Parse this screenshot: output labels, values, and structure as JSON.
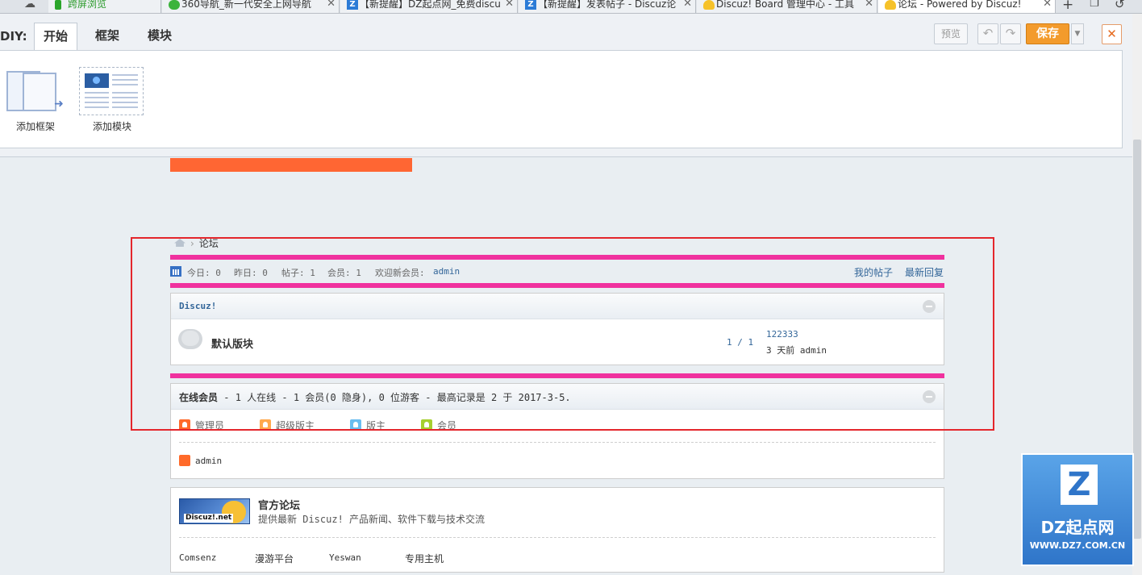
{
  "browser": {
    "tabs": [
      {
        "label": "跨屏浏览",
        "icon": "phone-icon"
      },
      {
        "label": "360导航_新一代安全上网导航",
        "icon": "360-icon"
      },
      {
        "label": "【新提醒】DZ起点网_免费discu",
        "icon": "dz-icon"
      },
      {
        "label": "【新提醒】发表帖子 - Discuz论",
        "icon": "dz-icon"
      },
      {
        "label": "Discuz! Board 管理中心 - 工具",
        "icon": "bulb-icon"
      },
      {
        "label": "论坛 - Powered by Discuz!",
        "icon": "bulb-icon"
      }
    ],
    "close_glyph": "✕",
    "plus_glyph": "+"
  },
  "diy": {
    "title": "DIY:",
    "tabs": [
      {
        "label": "开始"
      },
      {
        "label": "框架"
      },
      {
        "label": "模块"
      }
    ],
    "items": [
      {
        "label": "添加框架"
      },
      {
        "label": "添加模块"
      }
    ],
    "preview_label": "预览",
    "save_label": "保存",
    "undo_glyph": "↶",
    "redo_glyph": "↷",
    "close_glyph": "✕",
    "dropdown_glyph": "▼"
  },
  "breadcrumb": {
    "separator": "›",
    "current": "论坛"
  },
  "stats": {
    "today": "今日: 0",
    "yesterday": "昨日: 0",
    "posts": "帖子: 1",
    "members": "会员: 1",
    "welcome": "欢迎新会员:",
    "newest_member": "admin",
    "my_posts": "我的帖子",
    "latest_replies": "最新回复"
  },
  "forum_group": {
    "title": "Discuz!",
    "forum": {
      "name": "默认版块",
      "count": "1 / 1",
      "last_post_title": "122333",
      "last_post_meta": "3 天前 admin"
    }
  },
  "online": {
    "title_bold": "在线会员",
    "title_rest": " - 1 人在线 - 1 会员(0 隐身), 0 位游客 - 最高记录是 2 于 2017-3-5.",
    "legend": [
      {
        "label": "管理员",
        "color": "#ff6a2a"
      },
      {
        "label": "超级版主",
        "color": "#ffa94d"
      },
      {
        "label": "版主",
        "color": "#69bdf0"
      },
      {
        "label": "会员",
        "color": "#a6cf2f"
      }
    ],
    "user": "admin",
    "user_color": "#ff6a2a"
  },
  "official": {
    "logo_text": "Discuz!.net",
    "title": "官方论坛",
    "desc": "提供最新 Discuz! 产品新闻、软件下载与技术交流",
    "links": [
      "Comsenz",
      "漫游平台",
      "Yeswan",
      "专用主机"
    ]
  },
  "watermark": {
    "badge": "Z",
    "name": "DZ起点网",
    "url": "WWW.DZ7.COM.CN"
  },
  "colors": {
    "accent_orange": "#ff6633",
    "pink_bar": "#f0319e",
    "link_blue": "#336699",
    "highlight_red": "#e4262c",
    "save_orange": "#f39b2c"
  }
}
